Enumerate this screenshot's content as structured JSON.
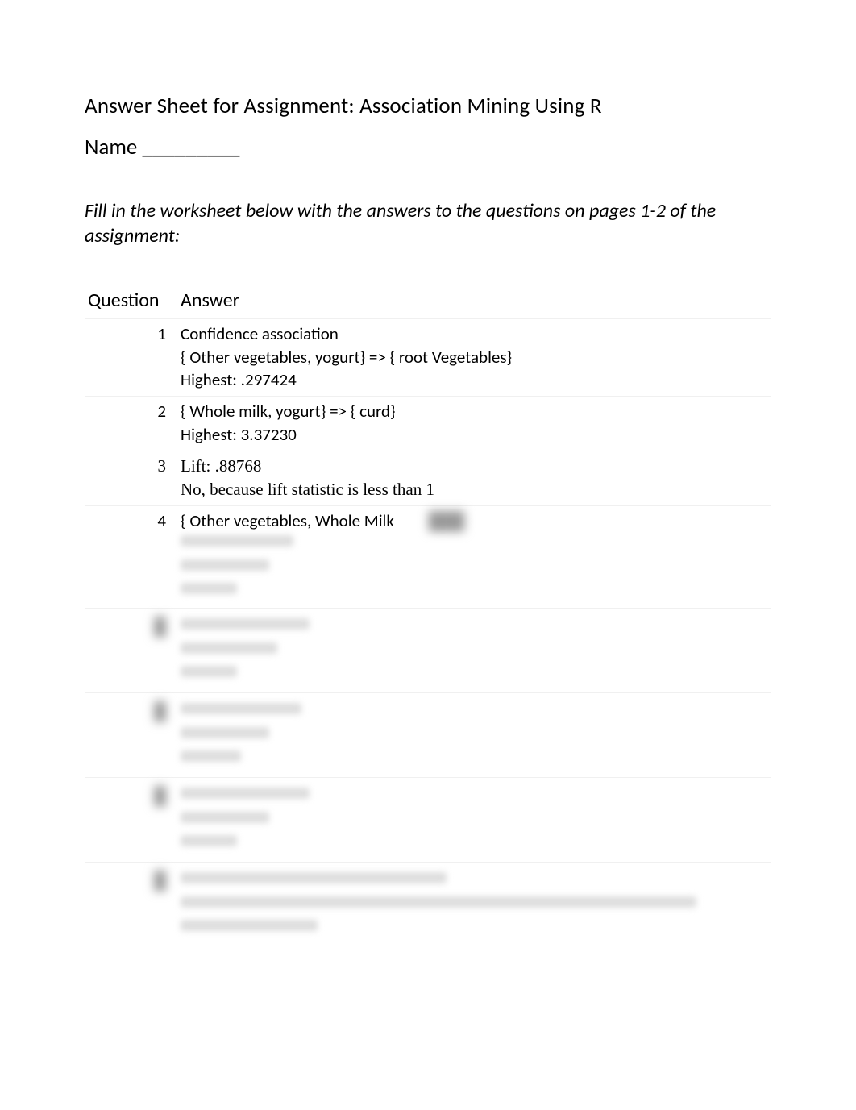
{
  "title": "Answer Sheet for Assignment: Association Mining Using R",
  "name_label": "Name _________",
  "instructions": "Fill in the worksheet below with the answers to the questions on pages 1-2 of the assignment:",
  "table": {
    "header_question": "Question",
    "header_answer": "Answer",
    "rows": [
      {
        "num": "1",
        "lines": [
          "Confidence association",
          "{ Other vegetables, yogurt} => { root Vegetables}",
          "Highest:  .297424"
        ]
      },
      {
        "num": "2",
        "lines": [
          "{ Whole milk, yogurt} => { curd}",
          "Highest: 3.37230"
        ]
      },
      {
        "num": "3",
        "lines_serif": [
          "Lift: .88768",
          "No, because lift statistic is less than 1"
        ]
      },
      {
        "num": "4",
        "lines": [
          "{ Other vegetables, Whole Milk"
        ]
      }
    ]
  }
}
